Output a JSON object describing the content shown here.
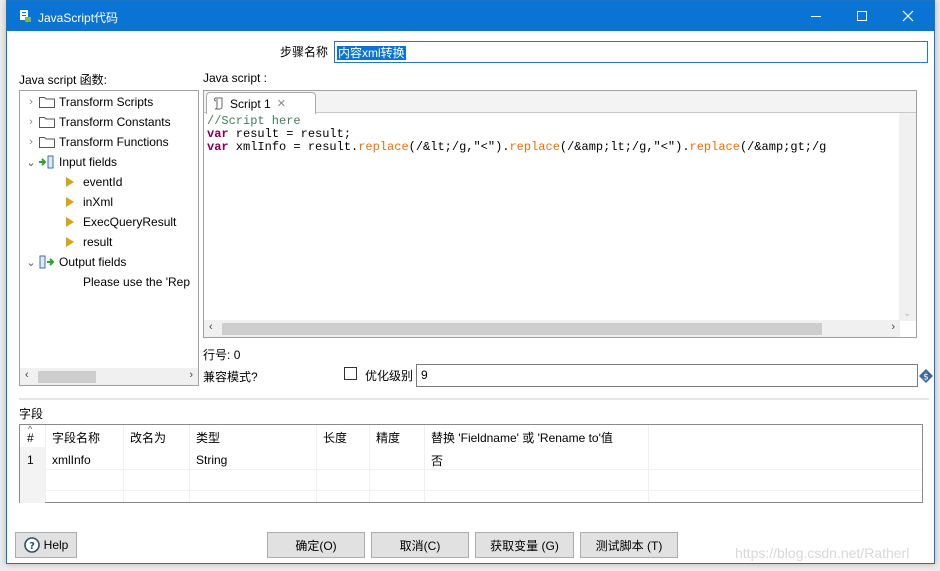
{
  "window": {
    "title": "JavaScript代码",
    "controls": {
      "minimize": "—",
      "maximize": "☐",
      "close": "✕"
    }
  },
  "step": {
    "label": "步骤名称",
    "value": "内容xml转换"
  },
  "functions_panel": {
    "label": "Java script 函数:",
    "items": [
      {
        "label": "Transform Scripts",
        "icon": "folder-icon",
        "expanded": false
      },
      {
        "label": "Transform Constants",
        "icon": "folder-icon",
        "expanded": false
      },
      {
        "label": "Transform Functions",
        "icon": "folder-icon",
        "expanded": false
      },
      {
        "label": "Input fields",
        "icon": "input-fields-icon",
        "expanded": true
      },
      {
        "label": "eventId",
        "icon": "field-arrow-icon"
      },
      {
        "label": "inXml",
        "icon": "field-arrow-icon"
      },
      {
        "label": "ExecQueryResult",
        "icon": "field-arrow-icon"
      },
      {
        "label": "result",
        "icon": "field-arrow-icon"
      },
      {
        "label": "Output fields",
        "icon": "output-fields-icon",
        "expanded": true
      },
      {
        "label": "Please use the 'Rep"
      }
    ]
  },
  "script_panel": {
    "label": "Java script :",
    "tab_label": "Script 1",
    "code": {
      "line1": "//Script here",
      "line2_kw": "var",
      "line2_rest": " result = result;",
      "line3_kw": "var",
      "line3_a": " xmlInfo = result.",
      "line3_fn1": "replace",
      "line3_b": "(/&lt;/g,\"<\").",
      "line3_fn2": "replace",
      "line3_c": "(/&amp;lt;/g,\"<\").",
      "line3_fn3": "replace",
      "line3_d": "(/&amp;gt;/g"
    }
  },
  "line_number": {
    "label": "行号:",
    "value": "0"
  },
  "compat_mode": {
    "label": "兼容模式?",
    "checked": false
  },
  "optimization": {
    "label": "优化级别",
    "value": "9"
  },
  "fields": {
    "label": "字段",
    "columns": [
      "#",
      "字段名称",
      "改名为",
      "类型",
      "长度",
      "精度",
      "替换 'Fieldname' 或 'Rename to'值"
    ],
    "rows": [
      [
        "1",
        "xmlInfo",
        "",
        "String",
        "",
        "",
        "否"
      ]
    ]
  },
  "buttons": {
    "help": "Help",
    "ok": "确定(O)",
    "cancel": "取消(C)",
    "get_vars": "获取变量 (G)",
    "test_script": "测试脚本 (T)"
  },
  "watermark": "https://blog.csdn.net/Ratherl"
}
